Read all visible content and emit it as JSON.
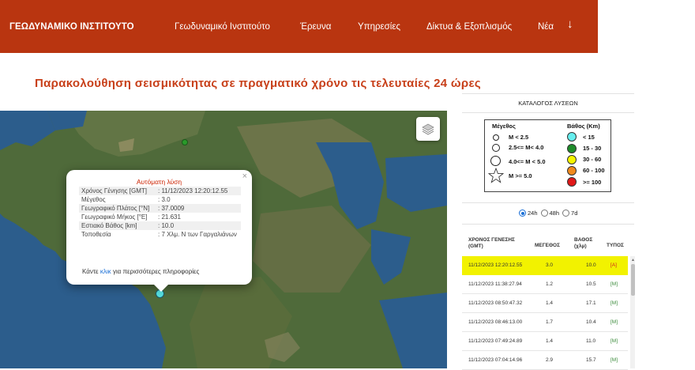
{
  "header": {
    "brand": "ΓΕΩΔΥΝΑΜΙΚΟ ΙΝΣΤΙΤΟΥΤΟ",
    "nav": [
      {
        "label": "Γεωδυναμικό Ινστιτούτο"
      },
      {
        "label": "Έρευνα"
      },
      {
        "label": "Υπηρεσίες"
      },
      {
        "label": "Δίκτυα & Εξοπλισμός"
      },
      {
        "label": "Νέα"
      }
    ],
    "arrow_icon": "arrow-down-icon",
    "bg_color": "#b93510"
  },
  "page_title": "Παρακολούθηση σεισμικότητας σε πραγματικό χρόνο τις τελευταίες 24 ώρες",
  "popup": {
    "title": "Αυτόματη λύση",
    "close": "×",
    "rows": [
      {
        "key": "Χρόνος Γένησης [GMT]",
        "value": ": 11/12/2023 12:20:12.55"
      },
      {
        "key": "Μέγεθος",
        "value": ": 3.0"
      },
      {
        "key": "Γεωγραφικό Πλάτος [°N]",
        "value": ": 37.0009"
      },
      {
        "key": "Γεωγραφικό Μήκος [°E]",
        "value": ": 21.631"
      },
      {
        "key": "Εστιακό Βάθος [km]",
        "value": ": 10.0"
      },
      {
        "key": "Τοποθεσία",
        "value": ": 7 Χλμ. Ν των Γαργαλιάνων"
      }
    ],
    "more_prefix": "Κάντε ",
    "more_link": "κλικ",
    "more_suffix": " για περισσότερες πληροφορίες"
  },
  "catalog": {
    "title": "ΚΑΤΑΛΟΓΟΣ ΛΥΣΕΩΝ",
    "legend": {
      "magnitude_header": "Μέγεθος",
      "depth_header": "Βάθος (Km)",
      "magnitudes": [
        "M < 2.5",
        "2.5<= M< 4.0",
        "4.0<= M < 5.0",
        "M >= 5.0"
      ],
      "depths": [
        {
          "label": "< 15",
          "color": "#66eeee"
        },
        {
          "label": "15 - 30",
          "color": "#1e8c2a"
        },
        {
          "label": "30 - 60",
          "color": "#f5f500"
        },
        {
          "label": "60 - 100",
          "color": "#f08a1e"
        },
        {
          "label": ">= 100",
          "color": "#e01818"
        }
      ]
    },
    "periods": [
      {
        "label": "24h",
        "selected": true
      },
      {
        "label": "48h",
        "selected": false
      },
      {
        "label": "7d",
        "selected": false
      }
    ],
    "columns": {
      "origin": "ΧΡΟΝΟΣ ΓΕΝΕΣΗΣ (GMT)",
      "magnitude": "ΜΕΓΕΘΟΣ",
      "depth": "ΒΑΘΟΣ (χλμ)",
      "type": "ΤΥΠΟΣ"
    },
    "rows": [
      {
        "time": "11/12/2023 12:20:12.55",
        "mag": "3.0",
        "depth": "10.0",
        "type": "[A]",
        "highlight": true
      },
      {
        "time": "11/12/2023 11:38:27.94",
        "mag": "1.2",
        "depth": "10.5",
        "type": "[M]",
        "highlight": false
      },
      {
        "time": "11/12/2023 08:50:47.32",
        "mag": "1.4",
        "depth": "17.1",
        "type": "[M]",
        "highlight": false
      },
      {
        "time": "11/12/2023 08:46:13.00",
        "mag": "1.7",
        "depth": "10.4",
        "type": "[M]",
        "highlight": false
      },
      {
        "time": "11/12/2023 07:49:24.89",
        "mag": "1.4",
        "depth": "11.0",
        "type": "[M]",
        "highlight": false
      },
      {
        "time": "11/12/2023 07:04:14.96",
        "mag": "2.9",
        "depth": "15.7",
        "type": "[M]",
        "highlight": false
      }
    ]
  },
  "map": {
    "layers_icon": "layers-icon",
    "events": [
      {
        "color": "#2a9a2a",
        "depth_class": "15 - 30"
      },
      {
        "color": "#56e0e0",
        "depth_class": "< 15"
      }
    ]
  }
}
